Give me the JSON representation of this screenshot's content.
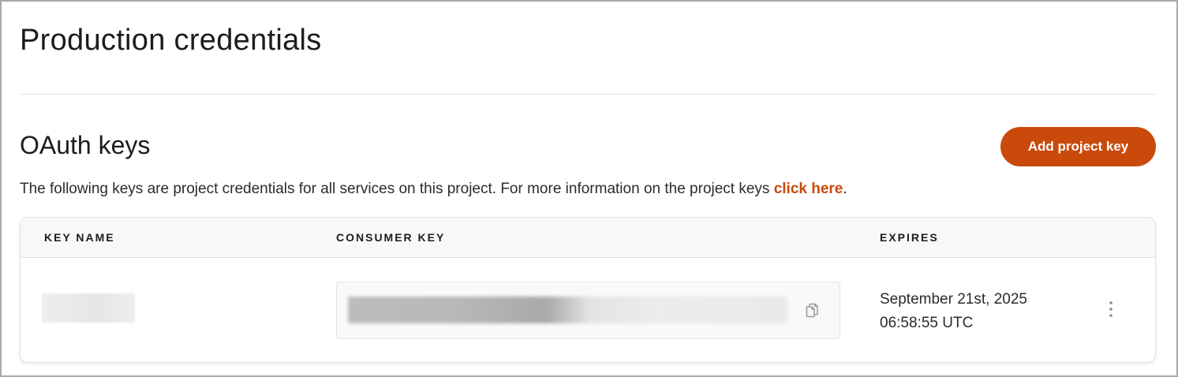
{
  "page": {
    "title": "Production credentials"
  },
  "oauth": {
    "title": "OAuth keys",
    "add_button_label": "Add project key",
    "description_prefix": "The following keys are project credentials for all services on this project. For more information on the project keys ",
    "description_link": "click here",
    "description_suffix": "."
  },
  "table": {
    "headers": {
      "key_name": "KEY NAME",
      "consumer_key": "CONSUMER KEY",
      "expires": "EXPIRES"
    },
    "rows": [
      {
        "expires_date": "September 21st, 2025",
        "expires_time": "06:58:55 UTC"
      }
    ]
  },
  "icons": {
    "copy": "copy-icon",
    "more": "more-vertical-icon"
  },
  "colors": {
    "accent": "#c94a0b",
    "header_bg": "#faf8f6",
    "text": "#1c1c1c"
  }
}
